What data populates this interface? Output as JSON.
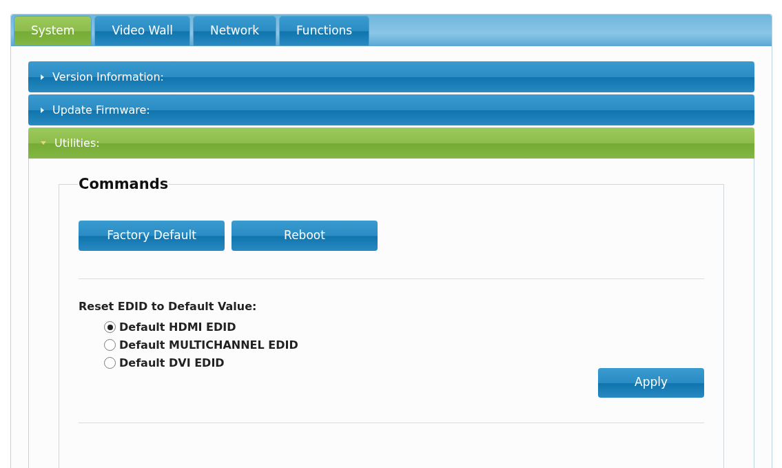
{
  "tabs": [
    {
      "label": "System",
      "selected": true
    },
    {
      "label": "Video Wall",
      "selected": false
    },
    {
      "label": "Network",
      "selected": false
    },
    {
      "label": "Functions",
      "selected": false
    }
  ],
  "sections": [
    {
      "title": "Version Information:",
      "expanded": false
    },
    {
      "title": "Update Firmware:",
      "expanded": false
    },
    {
      "title": "Utilities:",
      "expanded": true
    }
  ],
  "commands": {
    "legend": "Commands",
    "buttons": [
      "Factory Default",
      "Reboot"
    ],
    "edid_label": "Reset EDID to Default Value:",
    "edid_options": [
      {
        "label": "Default HDMI EDID",
        "selected": true
      },
      {
        "label": "Default MULTICHANNEL EDID",
        "selected": false
      },
      {
        "label": "Default DVI EDID",
        "selected": false
      }
    ],
    "apply": "Apply"
  }
}
